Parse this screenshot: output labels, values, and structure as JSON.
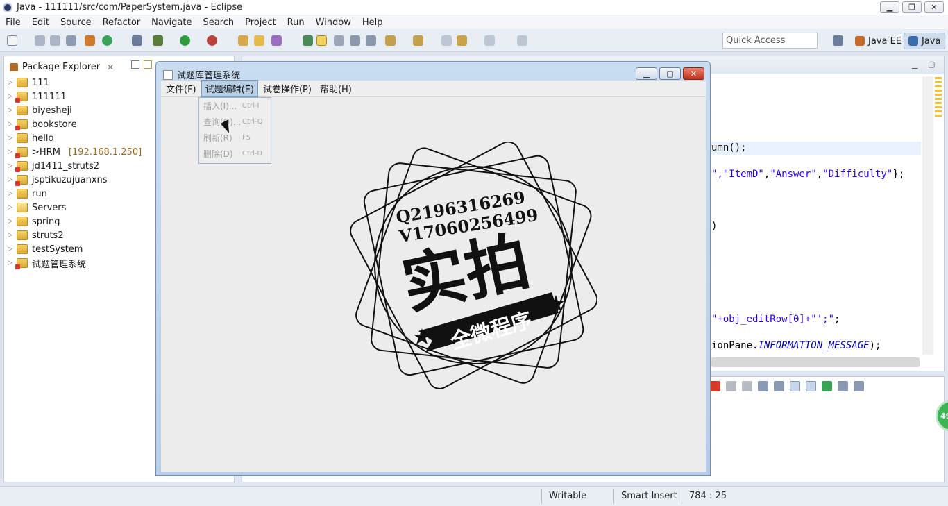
{
  "window": {
    "title": "Java - 111111/src/com/PaperSystem.java - Eclipse"
  },
  "menu": [
    "File",
    "Edit",
    "Source",
    "Refactor",
    "Navigate",
    "Search",
    "Project",
    "Run",
    "Window",
    "Help"
  ],
  "quick_access": "Quick Access",
  "perspectives": {
    "java_ee": "Java EE",
    "java": "Java"
  },
  "package_explorer": {
    "tab_label": "Package Explorer",
    "items": [
      {
        "label": "111"
      },
      {
        "label": "111111"
      },
      {
        "label": "biyesheji"
      },
      {
        "label": "bookstore"
      },
      {
        "label": "hello"
      },
      {
        "label": ">HRM",
        "extra": "[192.168.1.250]"
      },
      {
        "label": "jd1411_struts2"
      },
      {
        "label": "jsptikuzujuanxns"
      },
      {
        "label": "run"
      },
      {
        "label": "Servers"
      },
      {
        "label": "spring"
      },
      {
        "label": "struts2"
      },
      {
        "label": "testSystem"
      },
      {
        "label": "试题管理系统"
      }
    ]
  },
  "code_fragments": {
    "line1": "umn();",
    "line2_a": "\",",
    "line2_b": "\"ItemD\"",
    "line2_c": ",",
    "line2_d": "\"Answer\"",
    "line2_e": ",",
    "line2_f": "\"Difficulty\"",
    "line2_g": "};",
    "line3": ")",
    "line4_a": "\"+obj_editRow[0]+\"",
    "line4_b": "';\"",
    "line4_c": ";",
    "line5_a": "ionPane.",
    "line5_b": "INFORMATION_MESSAGE",
    "line5_c": ");"
  },
  "badge": "49",
  "status": {
    "writable": "Writable",
    "insert_mode": "Smart Insert",
    "position": "784 : 25"
  },
  "dialog": {
    "title": "试题库管理系统",
    "menus": [
      "文件(F)",
      "试题编辑(E)",
      "试卷操作(P)",
      "帮助(H)"
    ],
    "dropdown": [
      {
        "label": "插入(I)...",
        "accel": "Ctrl-I"
      },
      {
        "label": "查询(Q)...",
        "accel": "Ctrl-Q"
      },
      {
        "label": "刷新(R)",
        "accel": "F5"
      },
      {
        "label": "删除(D)",
        "accel": "Ctrl-D"
      }
    ],
    "watermark": {
      "contact_q": "Q2196316269",
      "contact_v": "V17060256499",
      "big_text": "实拍",
      "ribbon_text": "全微程序"
    }
  }
}
